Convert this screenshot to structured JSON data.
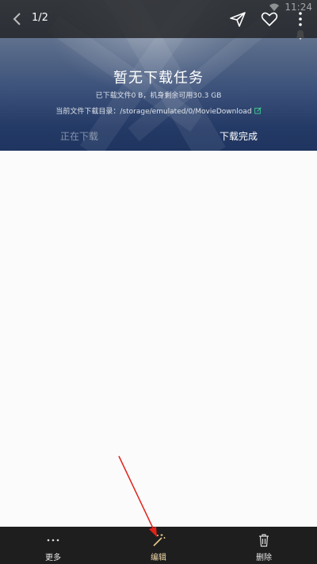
{
  "status": {
    "time": "11:24"
  },
  "viewer": {
    "counter": "1/2"
  },
  "download": {
    "title": "暂无下载任务",
    "usage": "已下载文件0 B，机身剩余可用30.3 GB",
    "dir_label": "当前文件下载目录：",
    "dir_path": "/storage/emulated/0/MovieDownload",
    "tabs": {
      "downloading": "正在下载",
      "done": "下载完成"
    }
  },
  "toolbar": {
    "more": "更多",
    "edit": "编辑",
    "delete": "删除"
  },
  "colors": {
    "toolbar_bg": "#1e1e1e",
    "hero_dark": "#1f3560",
    "accent": "#f0d8a8",
    "annotation_arrow": "#e2231a",
    "edit_dir_icon": "#3ecf8e"
  },
  "icons": [
    "back-icon",
    "share-icon",
    "heart-icon",
    "more-vert-icon",
    "wifi-icon",
    "bell-icon",
    "edit-dir-icon",
    "more-dots-icon",
    "edit-magic-icon",
    "trash-icon"
  ]
}
